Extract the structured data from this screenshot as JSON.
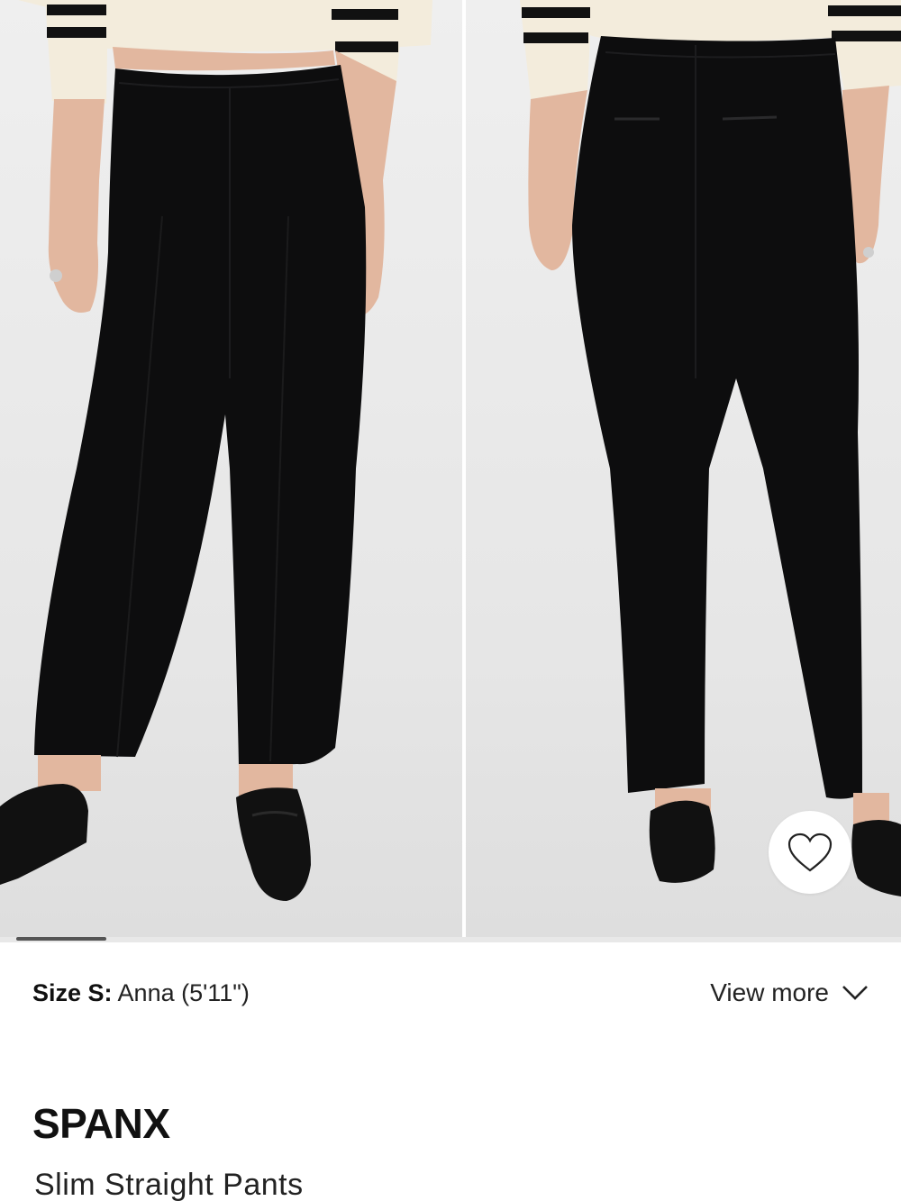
{
  "gallery": {
    "images": [
      {
        "view": "front"
      },
      {
        "view": "back"
      }
    ],
    "active_index": 1,
    "total_images": 10
  },
  "wishlist": {
    "icon": "heart-icon"
  },
  "model_info": {
    "size_label": "Size S:",
    "model_name": "Anna (5'11\")"
  },
  "view_more": {
    "label": "View more",
    "icon": "chevron-down-icon"
  },
  "product": {
    "brand": "SPANX",
    "name": "Slim Straight Pants"
  },
  "colors": {
    "garment": "#0d0d0e",
    "sweater": "#f3ecdc",
    "stripe": "#111111",
    "skin": "#e2b79f",
    "background": "#ececec"
  }
}
